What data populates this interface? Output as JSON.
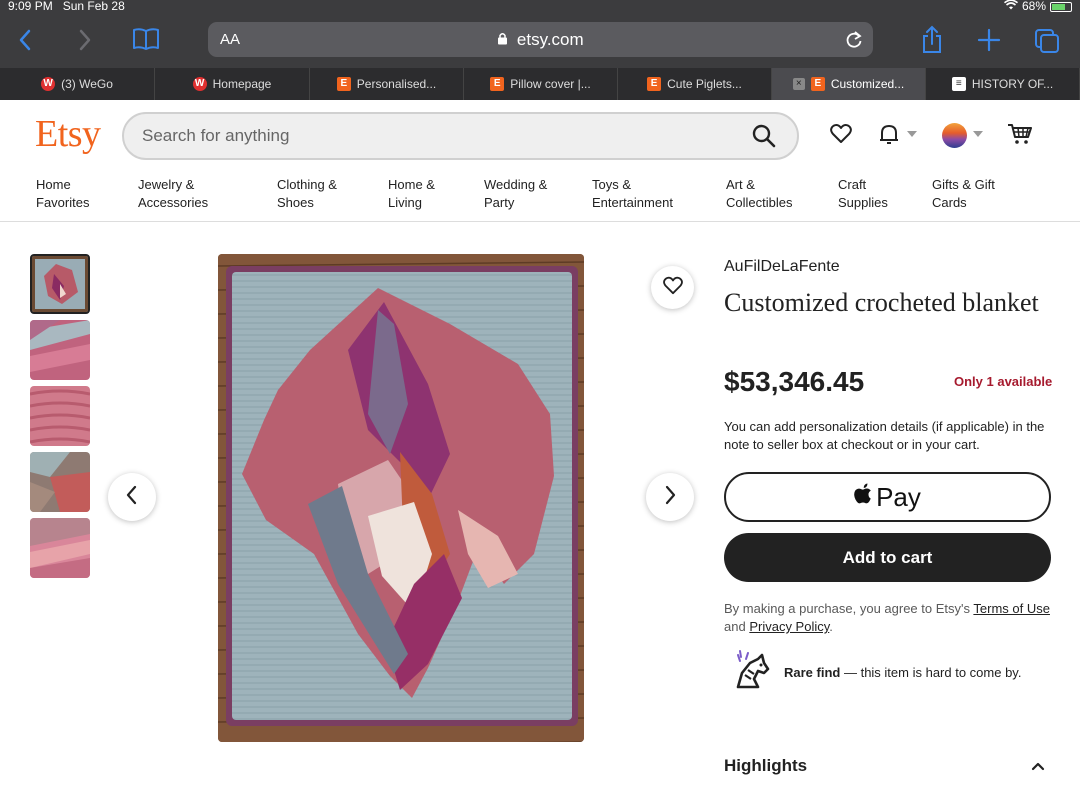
{
  "status_bar": {
    "time": "9:09 PM",
    "date": "Sun Feb 28",
    "battery": "68%"
  },
  "browser": {
    "address_aa": "AA",
    "url": "etsy.com",
    "tabs": [
      {
        "label": "(3) WeGo",
        "favicon": "W"
      },
      {
        "label": "Homepage",
        "favicon": "W"
      },
      {
        "label": "Personalised...",
        "favicon": "E"
      },
      {
        "label": "Pillow cover |...",
        "favicon": "E"
      },
      {
        "label": "Cute Piglets...",
        "favicon": "E"
      },
      {
        "label": "Customized...",
        "favicon": "E",
        "active": true
      },
      {
        "label": "HISTORY OF...",
        "favicon": "H"
      }
    ]
  },
  "header": {
    "logo": "Etsy",
    "search_placeholder": "Search for anything",
    "categories": [
      "Home\nFavorites",
      "Jewelry &\nAccessories",
      "Clothing &\nShoes",
      "Home &\nLiving",
      "Wedding &\nParty",
      "Toys &\nEntertainment",
      "Art &\nCollectibles",
      "Craft\nSupplies",
      "Gifts & Gift\nCards"
    ]
  },
  "listing": {
    "shop_name": "AuFilDeLaFente",
    "title": "Customized crocheted blanket",
    "price": "$53,346.45",
    "availability": "Only 1 available",
    "personalization_note": "You can add personalization details (if applicable) in the note to seller box at checkout or in your cart.",
    "apple_pay_label": "Pay",
    "add_to_cart_label": "Add to cart",
    "terms_prefix": "By making a purchase, you agree to Etsy's",
    "terms_link": "Terms of Use",
    "terms_and": "and",
    "privacy_link": "Privacy Policy",
    "terms_suffix": ".",
    "rare_title": "Rare find",
    "rare_text": "— this item is hard to come by.",
    "highlights_label": "Highlights"
  },
  "colors": {
    "brand": "#f1641e",
    "availability": "#a61a2e",
    "button_dark": "#222222",
    "browser_link": "#3a86e8"
  }
}
